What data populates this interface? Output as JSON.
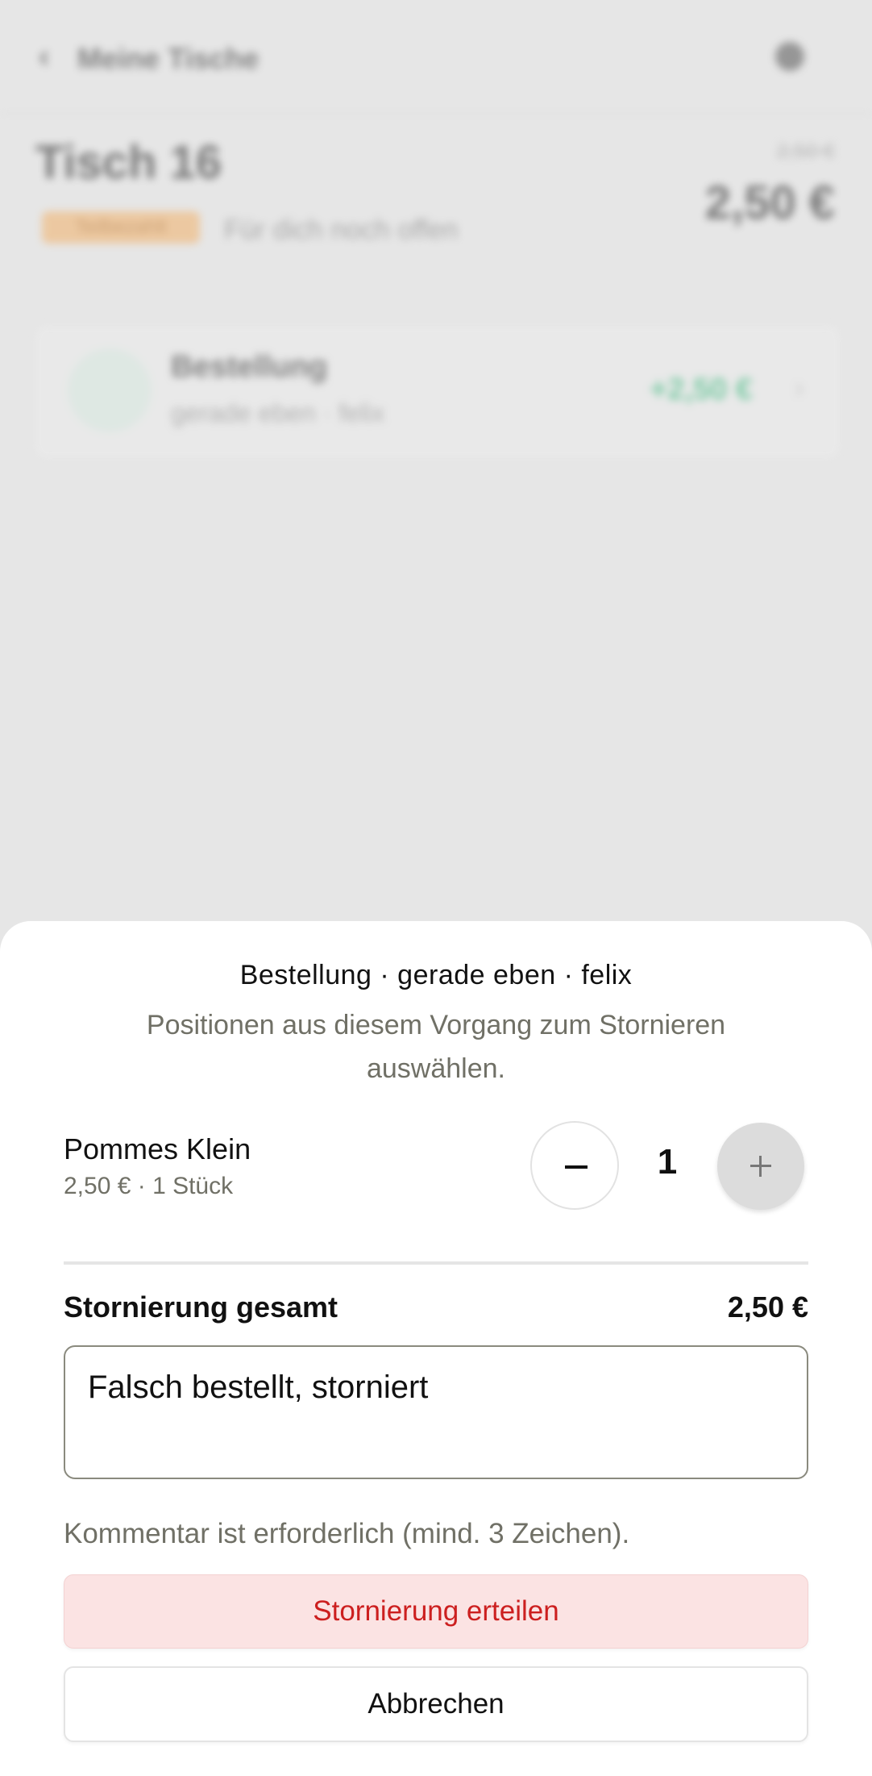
{
  "background": {
    "back_label": "Meine Tische",
    "title": "Tisch 16",
    "status_chip": "Teilbezahlt",
    "status_note": "Für dich noch offen",
    "old_price": "2,50 €",
    "price": "2,50 €",
    "card": {
      "icon_label": "B",
      "title": "Bestellung",
      "subtitle": "gerade eben · felix",
      "amount": "+2,50 €",
      "chevron": "›"
    }
  },
  "sheet": {
    "title": "Bestellung · gerade eben · felix",
    "subtitle": "Positionen aus diesem Vorgang zum Stornieren auswählen.",
    "item": {
      "name": "Pommes Klein",
      "meta": "2,50 € · 1 Stück",
      "quantity": "1"
    },
    "total_label": "Stornierung gesamt",
    "total_value": "2,50 €",
    "comment_value": "Falsch bestellt, storniert",
    "hint": "Kommentar ist erforderlich (mind. 3 Zeichen).",
    "confirm_label": "Stornierung erteilen",
    "cancel_label": "Abbrechen"
  },
  "icons": {
    "back": "chevron-left-icon",
    "user": "user-icon",
    "minus": "minus-icon",
    "plus": "plus-icon"
  },
  "colors": {
    "accent_red": "#cc1f1f",
    "confirm_bg": "#fbe3e3",
    "muted_text": "#707066",
    "chip_orange": "#f2b169",
    "amount_green": "#2bb673"
  }
}
